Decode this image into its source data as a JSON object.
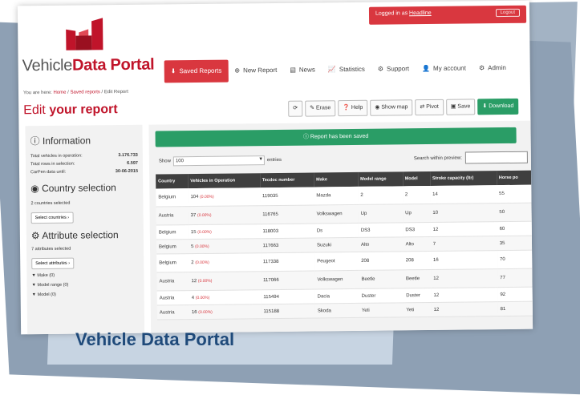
{
  "caption": "Vehicle Data Portal",
  "logo": {
    "text_regular": "Vehicle",
    "text_bold": "Data Portal"
  },
  "topbar": {
    "logged_in_prefix": "Logged in as",
    "user": "Headline",
    "logout": "Logout"
  },
  "nav": [
    {
      "label": "Saved Reports",
      "icon": "download-icon",
      "active": true
    },
    {
      "label": "New Report",
      "icon": "plus-circle-icon",
      "active": false
    },
    {
      "label": "News",
      "icon": "news-icon",
      "active": false
    },
    {
      "label": "Statistics",
      "icon": "chart-icon",
      "active": false
    },
    {
      "label": "Support",
      "icon": "support-icon",
      "active": false
    },
    {
      "label": "My account",
      "icon": "user-icon",
      "active": false
    },
    {
      "label": "Admin",
      "icon": "admin-icon",
      "active": false
    }
  ],
  "breadcrumb": {
    "prefix": "You are here:",
    "home": "Home",
    "saved": "Saved reports",
    "current": "Edit Report"
  },
  "page_title": {
    "regular": "Edit",
    "bold": "your report"
  },
  "toolbar": {
    "refresh": "⟳",
    "erase": "Erase",
    "help": "Help",
    "show_map": "Show map",
    "pivot": "Pivot",
    "save": "Save",
    "download": "Download"
  },
  "information": {
    "title": "Information",
    "rows": [
      {
        "label": "Total vehicles in operation:",
        "value": "3.176.733"
      },
      {
        "label": "Total rows in selection:",
        "value": "6.597"
      },
      {
        "label": "CarPen data until:",
        "value": "30-06-2015"
      }
    ]
  },
  "country_selection": {
    "title": "Country selection",
    "summary": "2 countries selected",
    "button": "Select countries ›"
  },
  "attribute_selection": {
    "title": "Attribute selection",
    "summary": "7 attributes selected",
    "button": "Select attributes ›",
    "filters": [
      "Make (0)",
      "Model range (0)",
      "Model (0)"
    ]
  },
  "notice": "Report has been saved",
  "show": {
    "label": "Show",
    "value": "100",
    "suffix": "entries"
  },
  "search_label": "Search within preview:",
  "table": {
    "headers": [
      "Country",
      "Vehicles in Operation",
      "Tecdoc number",
      "Make",
      "Model range",
      "Model",
      "Stroke capacity (ltr)",
      "Horse po"
    ],
    "rows": [
      {
        "country": "Belgium",
        "vio": "104",
        "pct": "(0.00%)",
        "tecdoc": "119035",
        "make": "Mazda",
        "range": "2",
        "model": "2",
        "stroke": "14",
        "hp": "55"
      },
      {
        "country": "Austria",
        "vio": "37",
        "pct": "(0.00%)",
        "tecdoc": "116765",
        "make": "Volkswagen",
        "range": "Up",
        "model": "Up",
        "stroke": "10",
        "hp": "50"
      },
      {
        "country": "Belgium",
        "vio": "15",
        "pct": "(0.00%)",
        "tecdoc": "118003",
        "make": "Ds",
        "range": "DS3",
        "model": "DS3",
        "stroke": "12",
        "hp": "60"
      },
      {
        "country": "Belgium",
        "vio": "5",
        "pct": "(0.00%)",
        "tecdoc": "117663",
        "make": "Suzuki",
        "range": "Alto",
        "model": "Alto",
        "stroke": "7",
        "hp": "35"
      },
      {
        "country": "Belgium",
        "vio": "2",
        "pct": "(0.00%)",
        "tecdoc": "117338",
        "make": "Peugeot",
        "range": "208",
        "model": "208",
        "stroke": "16",
        "hp": "70"
      },
      {
        "country": "Austria",
        "vio": "12",
        "pct": "(0.00%)",
        "tecdoc": "117066",
        "make": "Volkswagen",
        "range": "Beetle",
        "model": "Beetle",
        "stroke": "12",
        "hp": "77"
      },
      {
        "country": "Austria",
        "vio": "4",
        "pct": "(0.00%)",
        "tecdoc": "115494",
        "make": "Dacia",
        "range": "Duster",
        "model": "Duster",
        "stroke": "12",
        "hp": "92"
      },
      {
        "country": "Austria",
        "vio": "16",
        "pct": "(0.00%)",
        "tecdoc": "115188",
        "make": "Skoda",
        "range": "Yeti",
        "model": "Yeti",
        "stroke": "12",
        "hp": "81"
      }
    ]
  },
  "colors": {
    "brand_red": "#d9373f",
    "green": "#2a9d66",
    "slab": "#8ea0b4"
  }
}
